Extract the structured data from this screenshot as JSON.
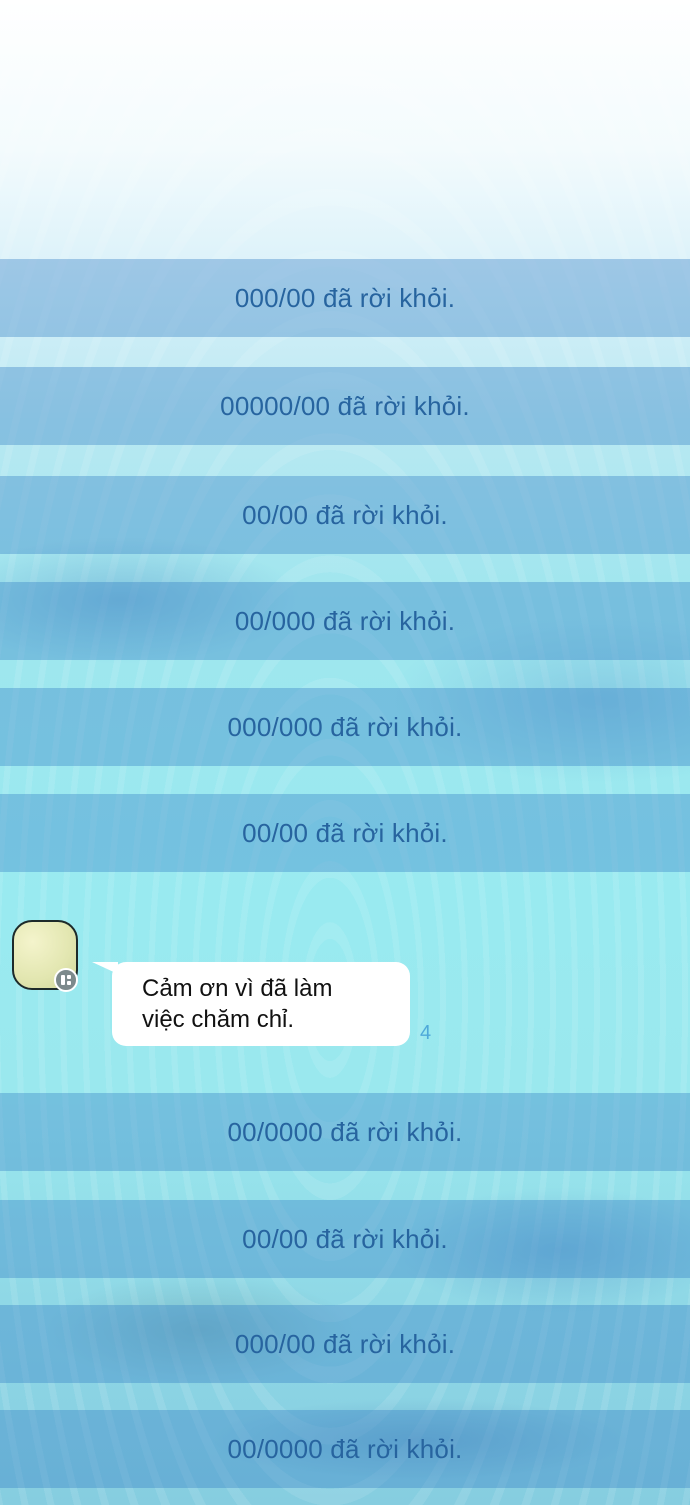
{
  "chat": {
    "system_messages_top": [
      "000/00 đã rời khỏi.",
      "00000/00 đã rời khỏi.",
      "00/00 đã rời khỏi.",
      "00/000 đã rời khỏi.",
      "000/000 đã rời khỏi.",
      "00/00 đã rời khỏi."
    ],
    "message": {
      "text": "Cảm ơn vì đã làm\nviệc chăm chỉ.",
      "unread_count": "4"
    },
    "system_messages_bottom": [
      "00/0000 đã rời khỏi.",
      "00/00 đã rời khỏi.",
      "000/00 đã rời khỏi.",
      "00/0000 đã rời khỏi."
    ]
  },
  "colors": {
    "system_text": "#27649f",
    "system_band": "#3682c4",
    "bubble": "#ffffff",
    "unread": "#4fa9d9"
  }
}
